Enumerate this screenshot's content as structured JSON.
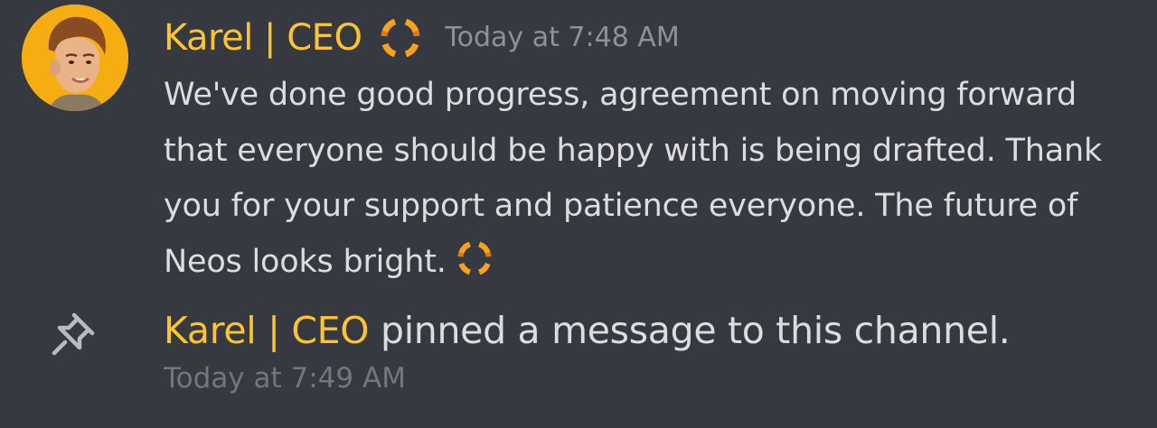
{
  "message": {
    "username": "Karel | CEO",
    "username_color": "#fdc42f",
    "role_icon": "orange-ring-icon",
    "timestamp": "Today at 7:48 AM",
    "text_lines": [
      "We've done good progress, agreement on moving forward",
      "that everyone should be happy with is being drafted. Thank",
      "you for your support and patience everyone. The future of",
      "Neos looks bright."
    ],
    "inline_emoji": "orange-ring-emoji"
  },
  "system_message": {
    "icon": "pin-icon",
    "username": "Karel | CEO",
    "action_text": "pinned a message to this channel.",
    "timestamp": "Today at 7:49 AM"
  },
  "colors": {
    "background": "#36393f",
    "text": "#dcddde",
    "timestamp": "#8e9297",
    "accent_orange": "#f7a21b"
  }
}
